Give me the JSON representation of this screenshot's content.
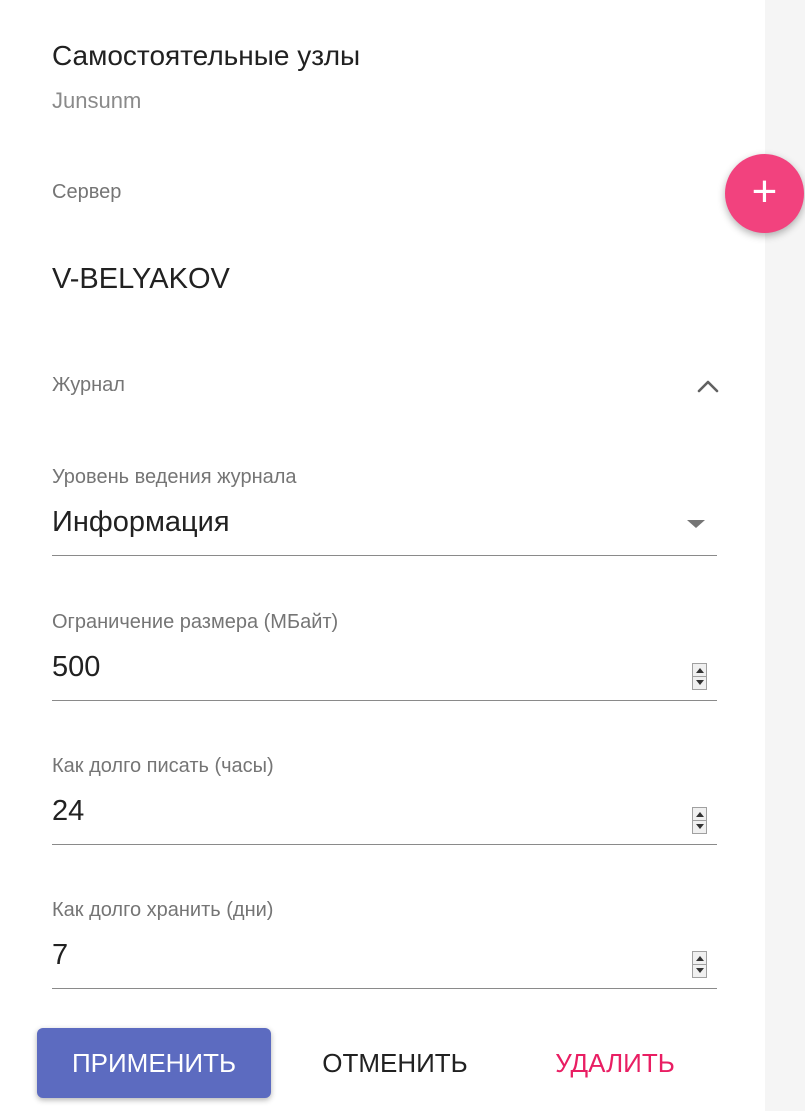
{
  "header": {
    "title": "Самостоятельные узлы",
    "subtitle": "Junsunm"
  },
  "server": {
    "label": "Сервер",
    "value": "V-BELYAKOV"
  },
  "journal": {
    "section_label": "Журнал",
    "expanded": true,
    "log_level": {
      "label": "Уровень ведения журнала",
      "value": "Информация"
    },
    "size_limit": {
      "label": "Ограничение размера (МБайт)",
      "value": "500"
    },
    "write_hours": {
      "label": "Как долго писать (часы)",
      "value": "24"
    },
    "keep_days": {
      "label": "Как долго хранить (дни)",
      "value": "7"
    }
  },
  "actions": {
    "apply_label": "ПРИМЕНИТЬ",
    "cancel_label": "ОТМЕНИТЬ",
    "delete_label": "УДАЛИТЬ"
  },
  "fab": {
    "icon": "plus-icon",
    "glyph": "+"
  },
  "colors": {
    "accent_pink": "#f2427e",
    "primary_button": "#5c6bc0",
    "delete_text": "#e91e63"
  }
}
